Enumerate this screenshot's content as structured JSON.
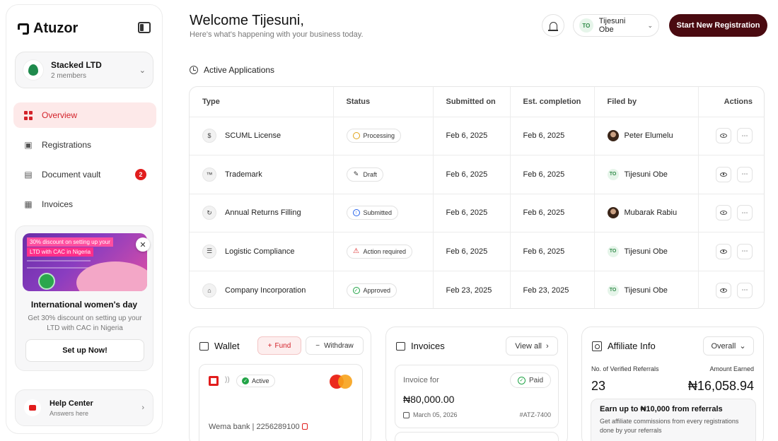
{
  "app": {
    "name": "Atuzor"
  },
  "org": {
    "name": "Stacked LTD",
    "members": "2 members"
  },
  "nav": [
    {
      "label": "Overview",
      "icon": "grid-icon",
      "active": true
    },
    {
      "label": "Registrations",
      "icon": "registrations-icon"
    },
    {
      "label": "Document vault",
      "icon": "document-icon",
      "badge": "2"
    },
    {
      "label": "Invoices",
      "icon": "invoice-icon"
    }
  ],
  "promo": {
    "banner_line1": "30% discount on setting up your",
    "banner_line2": "LTD with CAC in Nigeria",
    "title": "International women's day",
    "description": "Get 30% discount on setting up your LTD with CAC in Nigeria",
    "button": "Set up Now!"
  },
  "help": {
    "title": "Help Center",
    "subtitle": "Answers here"
  },
  "header": {
    "welcome": "Welcome Tijesuni,",
    "subtitle": "Here's what's happening with your business today.",
    "user_initials": "TO",
    "user_name": "Tijesuni Obe",
    "cta": "Start New Registration"
  },
  "applications": {
    "title": "Active Applications",
    "columns": [
      "Type",
      "Status",
      "Submitted on",
      "Est. completion",
      "Filed by",
      "Actions"
    ],
    "rows": [
      {
        "type": "SCUML License",
        "status": "Processing",
        "submitted": "Feb 6, 2025",
        "completion": "Feb 6, 2025",
        "filed_by": "Peter Elumelu",
        "avatar": "photo"
      },
      {
        "type": "Trademark",
        "status": "Draft",
        "submitted": "Feb 6, 2025",
        "completion": "Feb 6, 2025",
        "filed_by": "Tijesuni Obe",
        "avatar": "TO"
      },
      {
        "type": "Annual Returns Filling",
        "status": "Submitted",
        "submitted": "Feb 6, 2025",
        "completion": "Feb 6, 2025",
        "filed_by": "Mubarak Rabiu",
        "avatar": "photo"
      },
      {
        "type": "Logistic Compliance",
        "status": "Action required",
        "submitted": "Feb 6, 2025",
        "completion": "Feb 6, 2025",
        "filed_by": "Tijesuni Obe",
        "avatar": "TO"
      },
      {
        "type": "Company Incorporation",
        "status": "Approved",
        "submitted": "Feb 23, 2025",
        "completion": "Feb 23, 2025",
        "filed_by": "Tijesuni Obe",
        "avatar": "TO"
      }
    ]
  },
  "wallet": {
    "title": "Wallet",
    "fund": "Fund",
    "withdraw": "Withdraw",
    "status": "Active",
    "bank": "Wema bank | 2256289100"
  },
  "invoices": {
    "title": "Invoices",
    "view_all": "View all",
    "item": {
      "label": "Invoice for",
      "status": "Paid",
      "amount": "₦80,000.00",
      "date": "March 05, 2026",
      "id": "#ATZ-7400"
    }
  },
  "affiliate": {
    "title": "Affiliate Info",
    "filter": "Overall",
    "referrals_label": "No. of Verified Referrals",
    "earned_label": "Amount Earned",
    "referrals": "23",
    "earned": "₦16,058.94",
    "box_title": "Earn up to ₦10,000 from referrals",
    "box_desc": "Get affiliate commissions from every registrations done by your referrals"
  },
  "colors": {
    "brand": "#4a0a10",
    "accent": "#d3222a",
    "success": "#22a447"
  }
}
